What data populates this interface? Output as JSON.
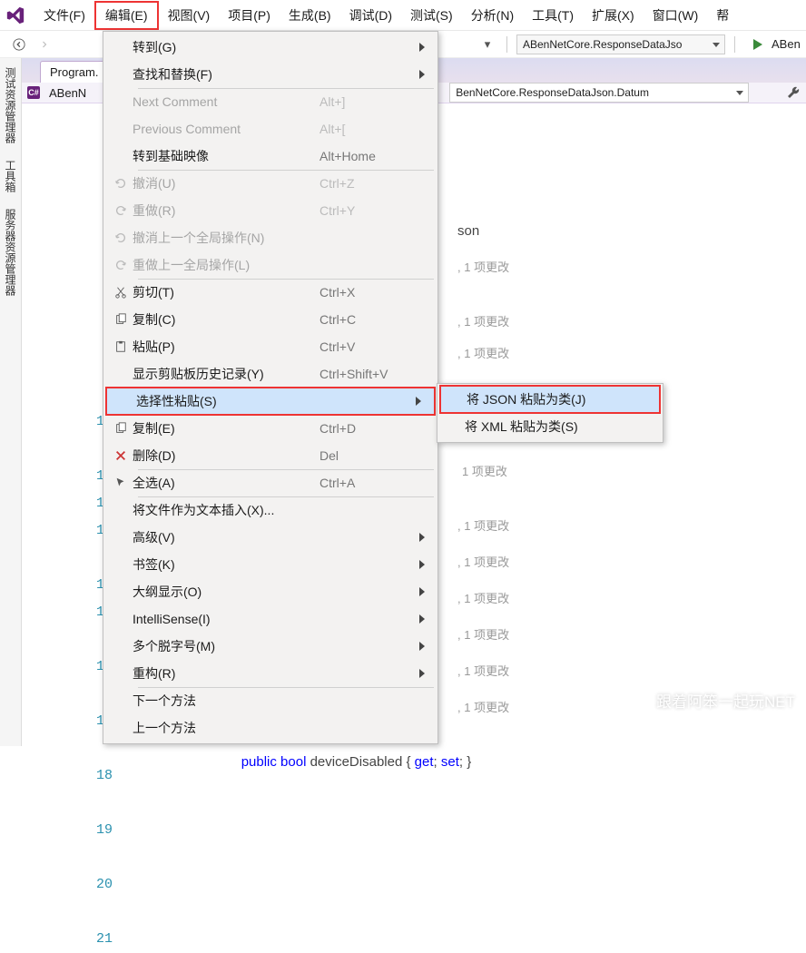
{
  "menubar": {
    "items": [
      "文件(F)",
      "编辑(E)",
      "视图(V)",
      "项目(P)",
      "生成(B)",
      "调试(D)",
      "测试(S)",
      "分析(N)",
      "工具(T)",
      "扩展(X)",
      "窗口(W)",
      "帮"
    ]
  },
  "toolbar": {
    "configCombo": "ABenNetCore.ResponseDataJso",
    "runLabel": "ABen"
  },
  "leftTabs": [
    "测试资源管理器",
    "工具箱",
    "服务器资源管理器"
  ],
  "docTab": "Program.",
  "navRow": {
    "project": "ABenN",
    "member": "BenNetCore.ResponseDataJson.Datum"
  },
  "editMenu": [
    {
      "label": "转到(G)",
      "shortcut": "",
      "arrow": true,
      "disabled": false,
      "icon": ""
    },
    {
      "label": "查找和替换(F)",
      "shortcut": "",
      "arrow": true,
      "disabled": false,
      "icon": "",
      "sep": true
    },
    {
      "label": "Next Comment",
      "shortcut": "Alt+]",
      "disabled": true,
      "icon": ""
    },
    {
      "label": "Previous Comment",
      "shortcut": "Alt+[",
      "disabled": true,
      "icon": ""
    },
    {
      "label": "转到基础映像",
      "shortcut": "Alt+Home",
      "disabled": false,
      "icon": "",
      "sep": true
    },
    {
      "label": "撤消(U)",
      "shortcut": "Ctrl+Z",
      "disabled": true,
      "icon": "undo"
    },
    {
      "label": "重做(R)",
      "shortcut": "Ctrl+Y",
      "disabled": true,
      "icon": "redo"
    },
    {
      "label": "撤消上一个全局操作(N)",
      "shortcut": "",
      "disabled": true,
      "icon": "undo"
    },
    {
      "label": "重做上一全局操作(L)",
      "shortcut": "",
      "disabled": true,
      "icon": "redo",
      "sep": true
    },
    {
      "label": "剪切(T)",
      "shortcut": "Ctrl+X",
      "disabled": false,
      "icon": "cut"
    },
    {
      "label": "复制(C)",
      "shortcut": "Ctrl+C",
      "disabled": false,
      "icon": "copy"
    },
    {
      "label": "粘贴(P)",
      "shortcut": "Ctrl+V",
      "disabled": false,
      "icon": "paste"
    },
    {
      "label": "显示剪贴板历史记录(Y)",
      "shortcut": "Ctrl+Shift+V",
      "disabled": false,
      "icon": ""
    },
    {
      "label": "选择性粘贴(S)",
      "shortcut": "",
      "arrow": true,
      "disabled": false,
      "highlight": true,
      "icon": ""
    },
    {
      "label": "复制(E)",
      "shortcut": "Ctrl+D",
      "disabled": false,
      "icon": "copy"
    },
    {
      "label": "删除(D)",
      "shortcut": "Del",
      "disabled": false,
      "icon": "delete",
      "sep": true
    },
    {
      "label": "全选(A)",
      "shortcut": "Ctrl+A",
      "disabled": false,
      "icon": "select",
      "sep": true
    },
    {
      "label": "将文件作为文本插入(X)...",
      "shortcut": "",
      "disabled": false,
      "icon": ""
    },
    {
      "label": "高级(V)",
      "shortcut": "",
      "arrow": true,
      "disabled": false,
      "icon": ""
    },
    {
      "label": "书签(K)",
      "shortcut": "",
      "arrow": true,
      "disabled": false,
      "icon": ""
    },
    {
      "label": "大纲显示(O)",
      "shortcut": "",
      "arrow": true,
      "disabled": false,
      "icon": ""
    },
    {
      "label": "IntelliSense(I)",
      "shortcut": "",
      "arrow": true,
      "disabled": false,
      "icon": ""
    },
    {
      "label": "多个脱字号(M)",
      "shortcut": "",
      "arrow": true,
      "disabled": false,
      "icon": ""
    },
    {
      "label": "重构(R)",
      "shortcut": "",
      "arrow": true,
      "disabled": false,
      "icon": "",
      "sep": true
    },
    {
      "label": "下一个方法",
      "shortcut": "",
      "disabled": false,
      "icon": ""
    },
    {
      "label": "上一个方法",
      "shortcut": "",
      "disabled": false,
      "icon": ""
    }
  ],
  "submenu": [
    {
      "label": "将 JSON 粘贴为类(J)",
      "highlight": true
    },
    {
      "label": "将 XML 粘贴为类(S)"
    }
  ],
  "code": {
    "lineStart": 2,
    "fragmentRight": "son",
    "refHints": [
      ", 1 项更改",
      ", 1 项更改",
      ", 1 项更改",
      "1 项更改",
      ", 1 项更改",
      ", 1 项更改",
      ", 1 项更改",
      ", 1 项更改",
      ", 1 项更改",
      ", 1 项更改"
    ],
    "line21a_kw": "public bool",
    "line21a_id": " deviceDisabled { ",
    "line21a_get": "get",
    "line21a_sep": "; ",
    "line21a_set": "set",
    "line21a_end": "; }"
  },
  "watermark": "跟着阿笨一起玩NET"
}
